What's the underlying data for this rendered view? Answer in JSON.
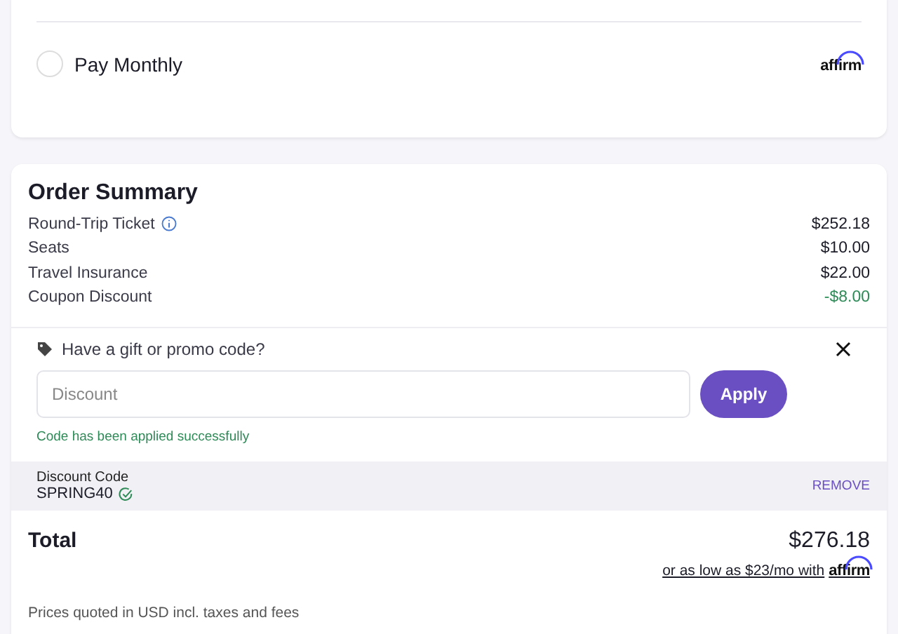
{
  "payment_option": {
    "label": "Pay Monthly",
    "selected": false,
    "logo": "affirm"
  },
  "order_summary": {
    "title": "Order Summary",
    "lines": [
      {
        "label": "Round-Trip Ticket",
        "amount": "$252.18",
        "info": true,
        "kind": "charge"
      },
      {
        "label": "Seats",
        "amount": "$10.00",
        "info": false,
        "kind": "charge"
      },
      {
        "label": "Travel Insurance",
        "amount": "$22.00",
        "info": false,
        "kind": "charge"
      },
      {
        "label": "Coupon Discount",
        "amount": "-$8.00",
        "info": false,
        "kind": "discount"
      }
    ]
  },
  "promo": {
    "title": "Have a gift or promo code?",
    "placeholder": "Discount",
    "button": "Apply",
    "message": "Code has been applied successfully"
  },
  "applied_code": {
    "label": "Discount Code",
    "code": "SPRING40",
    "verified": true,
    "action": "REMOVE"
  },
  "total": {
    "label": "Total",
    "amount": "$276.18",
    "financing": "or as low as $23/mo with",
    "financing_logo": "affirm"
  },
  "footnote": "Prices quoted in USD incl. taxes and fees"
}
